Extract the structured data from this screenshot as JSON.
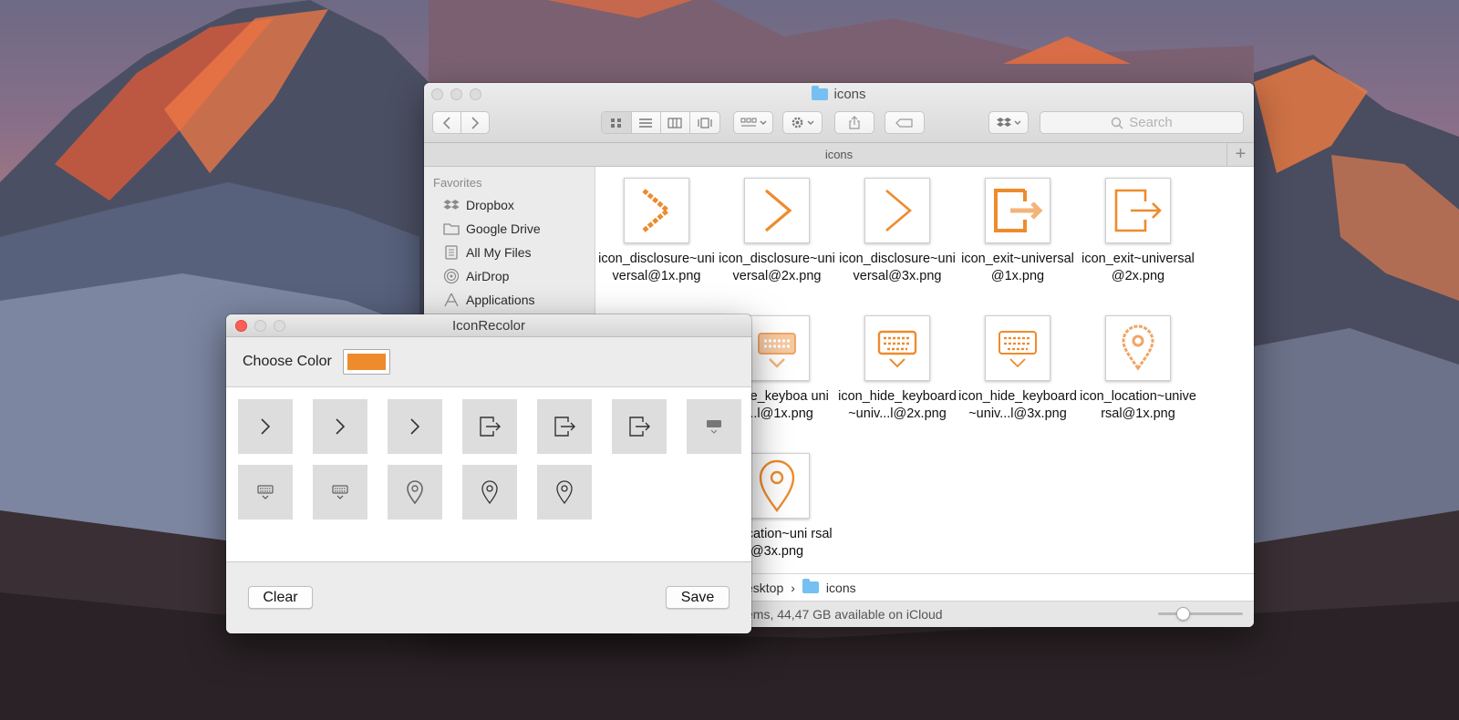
{
  "finder": {
    "title": "icons",
    "path_tab": "icons",
    "new_tab": "+",
    "search_placeholder": "Search",
    "sidebar": {
      "heading": "Favorites",
      "items": [
        {
          "label": "Dropbox",
          "icon": "dropbox-icon"
        },
        {
          "label": "Google Drive",
          "icon": "folder-icon"
        },
        {
          "label": "All My Files",
          "icon": "all-files-icon"
        },
        {
          "label": "AirDrop",
          "icon": "airdrop-icon"
        },
        {
          "label": "Applications",
          "icon": "applications-icon"
        }
      ]
    },
    "files": [
      {
        "name": "icon_disclosure~universal@1x.png",
        "icon": "chevron-right-icon"
      },
      {
        "name": "icon_disclosure~universal@2x.png",
        "icon": "chevron-right-icon"
      },
      {
        "name": "icon_disclosure~universal@3x.png",
        "icon": "chevron-right-icon"
      },
      {
        "name": "icon_exit~universal@1x.png",
        "icon": "exit-icon"
      },
      {
        "name": "icon_exit~universal@2x.png",
        "icon": "exit-icon"
      },
      {
        "name": "_hide_keyboa univ...l@1x.png",
        "icon": "keyboard-icon"
      },
      {
        "name": "icon_hide_keyboard~univ...l@2x.png",
        "icon": "keyboard-icon"
      },
      {
        "name": "icon_hide_keyboard~univ...l@3x.png",
        "icon": "keyboard-icon"
      },
      {
        "name": "icon_location~universal@1x.png",
        "icon": "location-pin-icon"
      },
      {
        "name": "n_location~uni rsal@3x.png",
        "icon": "location-pin-icon"
      }
    ],
    "path_bar": {
      "parent": "esktop",
      "current": "icons",
      "separator": "›"
    },
    "status": "ems, 44,47 GB available on iCloud",
    "zoom_level": 0.25
  },
  "recolor": {
    "title": "IconRecolor",
    "choose_color_label": "Choose Color",
    "selected_color": "#ee8b2d",
    "tiles": [
      "chevron-right-icon",
      "chevron-right-icon",
      "chevron-right-icon",
      "exit-icon",
      "exit-icon",
      "exit-icon",
      "keyboard-icon",
      "keyboard-icon",
      "keyboard-icon",
      "location-pin-icon",
      "location-pin-icon",
      "location-pin-icon"
    ],
    "clear_label": "Clear",
    "save_label": "Save"
  }
}
